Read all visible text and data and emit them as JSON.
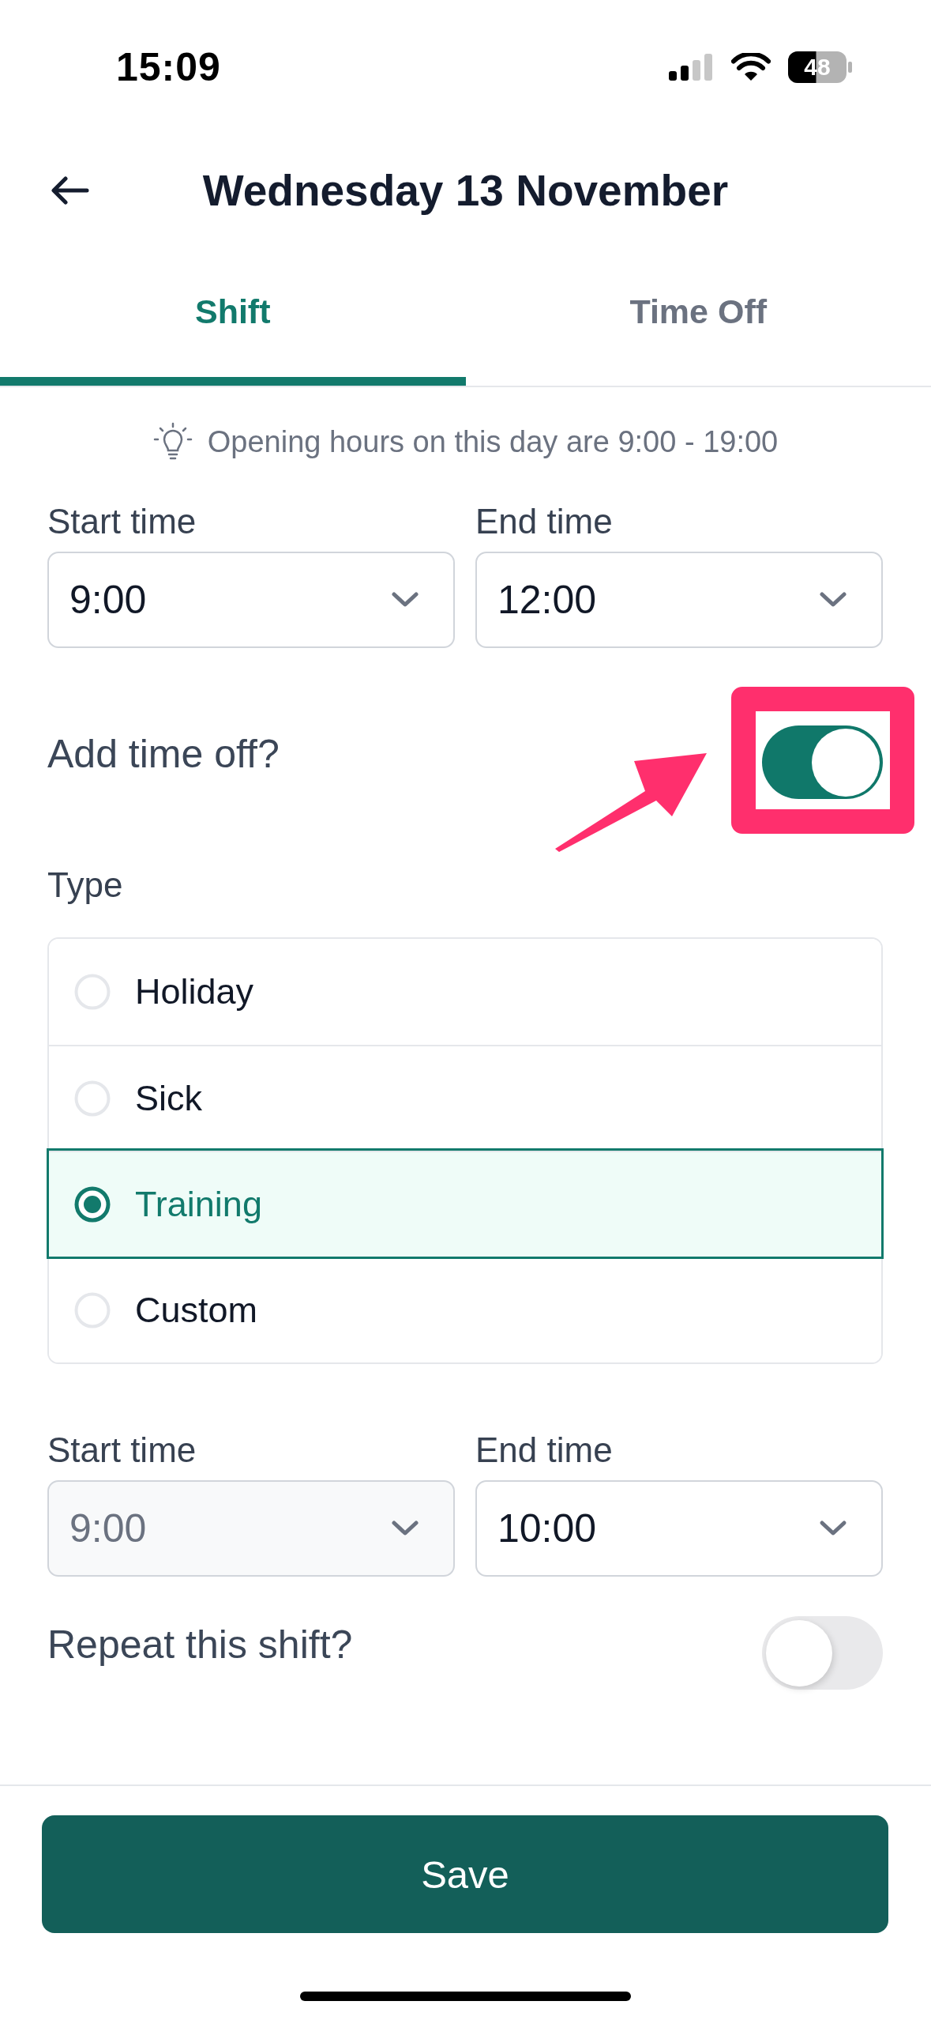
{
  "status_bar": {
    "time": "15:09",
    "battery": "48"
  },
  "header": {
    "title": "Wednesday 13 November"
  },
  "tabs": [
    {
      "label": "Shift",
      "selected": true
    },
    {
      "label": "Time Off",
      "selected": false
    }
  ],
  "hint": "Opening hours on this day are 9:00 - 19:00",
  "shift_times": [
    {
      "label": "Start time",
      "value": "9:00",
      "disabled": false
    },
    {
      "label": "End time",
      "value": "12:00",
      "disabled": false
    }
  ],
  "add_time_off": {
    "label": "Add time off?",
    "on": true,
    "highlighted": true
  },
  "type": {
    "label": "Type",
    "options": [
      {
        "label": "Holiday",
        "selected": false
      },
      {
        "label": "Sick",
        "selected": false
      },
      {
        "label": "Training",
        "selected": true
      },
      {
        "label": "Custom",
        "selected": false
      }
    ]
  },
  "time_off_times": [
    {
      "label": "Start time",
      "value": "9:00",
      "disabled": true
    },
    {
      "label": "End time",
      "value": "10:00",
      "disabled": false
    }
  ],
  "repeat": {
    "label": "Repeat this shift?",
    "on": false
  },
  "save_button": "Save"
}
